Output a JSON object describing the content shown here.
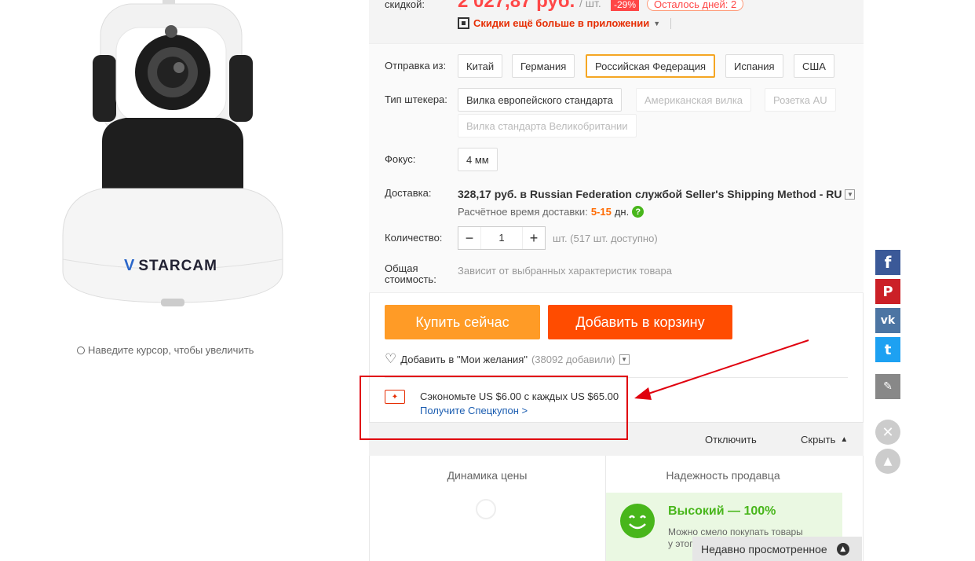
{
  "price": {
    "label": "скидкой:",
    "value": "2 027,87 руб.",
    "unit": "/ шт.",
    "discount": "-29%",
    "days_left": "Осталось дней: 2",
    "app_promo": "Скидки ещё больше в приложении"
  },
  "ship_from": {
    "label": "Отправка из:",
    "options": [
      "Китай",
      "Германия",
      "Российская Федерация",
      "Испания",
      "США"
    ],
    "selected": "Российская Федерация"
  },
  "plug": {
    "label": "Тип штекера:",
    "options": [
      "Вилка европейского стандарта",
      "Американская вилка",
      "Розетка AU",
      "Вилка стандарта Великобритании"
    ]
  },
  "focus": {
    "label": "Фокус:",
    "options": [
      "4 мм"
    ]
  },
  "delivery": {
    "label": "Доставка:",
    "price": "328,17 руб.",
    "by": "в",
    "destination": "Russian Federation",
    "service_word": "службой",
    "method": "Seller's Shipping Method - RU",
    "eta_label": "Расчётное время доставки:",
    "eta_value": "5-15",
    "eta_unit": "дн."
  },
  "quantity": {
    "label": "Количество:",
    "value": "1",
    "minus": "−",
    "plus": "+",
    "availability": "шт. (517 шт. доступно)"
  },
  "total": {
    "label_line1": "Общая",
    "label_line2": "стоимость:",
    "value": "Зависит от выбранных характеристик товара"
  },
  "actions": {
    "buy_now": "Купить сейчас",
    "add_to_cart": "Добавить в корзину"
  },
  "wishlist": {
    "label": "Добавить в \"Мои желания\"",
    "count": "(38092 добавили)"
  },
  "coupon": {
    "text": "Сэкономьте US $6.00 с каждых US $65.00",
    "link": "Получите Спецкупон >"
  },
  "coupon_bar": {
    "disable": "Отключить",
    "hide": "Скрыть",
    "hide_arrow": "▲"
  },
  "zoom_hint": "Наведите курсор, чтобы увеличить",
  "product_brand": "STARCAM",
  "tabs": {
    "price_dynamics": "Динамика цены",
    "seller_reliability": "Надежность продавца"
  },
  "seller": {
    "rating": "Высокий — 100%",
    "note_line1": "Можно смело покупать товары",
    "note_line2": "у этого"
  },
  "recently_viewed": "Недавно просмотренное",
  "social": {
    "facebook": "f",
    "pinterest": "P",
    "vk": "vk",
    "twitter": "t",
    "colors": {
      "facebook": "#3b5998",
      "pinterest": "#cb2027",
      "vk": "#4c75a3",
      "twitter": "#1da1f2",
      "edit": "#888888"
    }
  },
  "colors": {
    "accent_orange": "#ff6a00",
    "buy_now": "#ff9b26",
    "price_red": "#ff4747",
    "link_blue": "#1a5cb0",
    "green": "#48b61b",
    "annotation_red": "#e0000e"
  }
}
